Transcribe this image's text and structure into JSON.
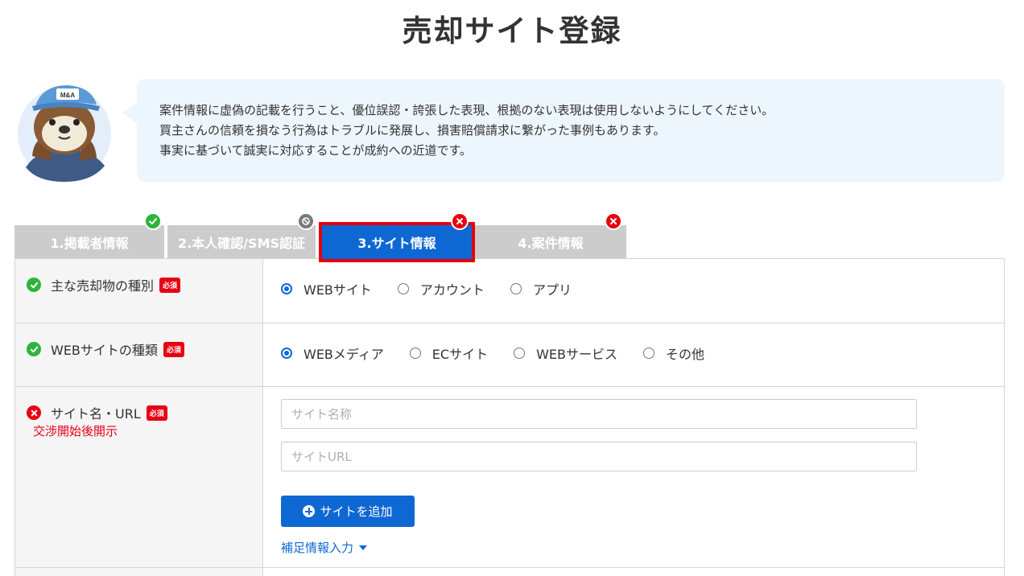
{
  "page": {
    "title": "売却サイト登録"
  },
  "notice": {
    "lines": [
      "案件情報に虚偽の記載を行うこと、優位誤認・誇張した表現、根拠のない表現は使用しないようにしてください。",
      "買主さんの信頼を損なう行為はトラブルに発展し、損害賠償請求に繋がった事例もあります。",
      "事実に基づいて誠実に対応することが成約への近道です。"
    ],
    "mascot_cap_text": "M&A"
  },
  "tabs": [
    {
      "label": "1.掲載者情報",
      "status": "complete"
    },
    {
      "label": "2.本人確認/SMS認証",
      "status": "disabled"
    },
    {
      "label": "3.サイト情報",
      "status": "error",
      "active": true
    },
    {
      "label": "4.案件情報",
      "status": "error"
    }
  ],
  "form": {
    "required_badge": "必須",
    "rows": [
      {
        "label": "主な売却物の種別",
        "status": "complete",
        "options": [
          {
            "label": "WEBサイト",
            "selected": true
          },
          {
            "label": "アカウント",
            "selected": false
          },
          {
            "label": "アプリ",
            "selected": false
          }
        ]
      },
      {
        "label": "WEBサイトの種類",
        "status": "complete",
        "options": [
          {
            "label": "WEBメディア",
            "selected": true
          },
          {
            "label": "ECサイト",
            "selected": false
          },
          {
            "label": "WEBサービス",
            "selected": false
          },
          {
            "label": "その他",
            "selected": false
          }
        ]
      },
      {
        "label": "サイト名・URL",
        "status": "error",
        "note": "交渉開始後開示",
        "name_input": {
          "value": "",
          "placeholder": "サイト名称"
        },
        "url_input": {
          "value": "",
          "placeholder": "サイトURL"
        },
        "add_button": "サイトを追加",
        "more_link": "補足情報入力"
      }
    ]
  },
  "colors": {
    "primary": "#0e68d3",
    "success": "#2fb43a",
    "error": "#e60012",
    "disabled": "#7a7a7a",
    "notice_bg": "#eef6fd"
  }
}
